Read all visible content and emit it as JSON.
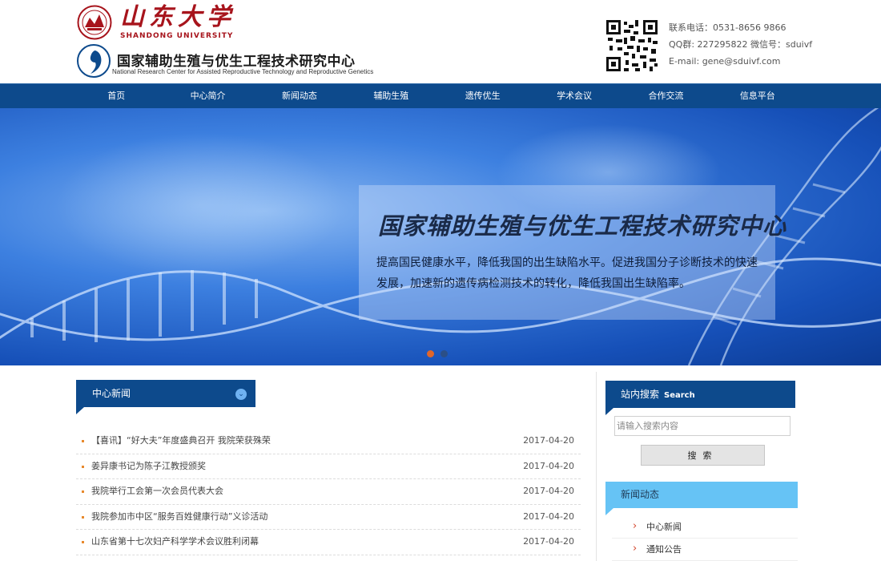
{
  "header": {
    "university_name": "山东大学",
    "university_en": "SHANDONG UNIVERSITY",
    "center_name_cn": "国家辅助生殖与优生工程技术研究中心",
    "center_name_en": "National  Research Center for Assisted Reproductive Technology and Reproductive Genetics",
    "contact": {
      "phone": "联系电话：0531-8656 9866",
      "qq_wechat": "QQ群: 227295822 微信号：sduivf",
      "email": "E-mail: gene@sduivf.com"
    }
  },
  "nav": {
    "items": [
      "首页",
      "中心简介",
      "新闻动态",
      "辅助生殖",
      "遗传优生",
      "学术会议",
      "合作交流",
      "信息平台"
    ]
  },
  "banner": {
    "title": "国家辅助生殖与优生工程技术研究中心",
    "text": "提高国民健康水平，降低我国的出生缺陷水平。促进我国分子诊断技术的快速发展，加速新的遗传病检测技术的转化，降低我国出生缺陷率。"
  },
  "news": {
    "heading": "中心新闻",
    "items": [
      {
        "title": "【喜讯】“好大夫”年度盛典召开 我院荣获殊荣",
        "date": "2017-04-20"
      },
      {
        "title": "姜异康书记为陈子江教授颁奖",
        "date": "2017-04-20"
      },
      {
        "title": "我院举行工会第一次会员代表大会",
        "date": "2017-04-20"
      },
      {
        "title": "我院参加市中区“服务百姓健康行动”义诊活动",
        "date": "2017-04-20"
      },
      {
        "title": "山东省第十七次妇产科学学术会议胜利闭幕",
        "date": "2017-04-20"
      }
    ]
  },
  "sidebar": {
    "search_heading": "站内搜索",
    "search_heading_en": "Search",
    "search_placeholder": "请输入搜索内容",
    "search_button": "搜索",
    "news_heading": "新闻动态",
    "news_links": [
      "中心新闻",
      "通知公告"
    ]
  },
  "colors": {
    "nav_bg": "#0d4a8c",
    "accent_light": "#66c3f5",
    "brand_red": "#a7141c",
    "bullet_orange": "#e7892d"
  }
}
